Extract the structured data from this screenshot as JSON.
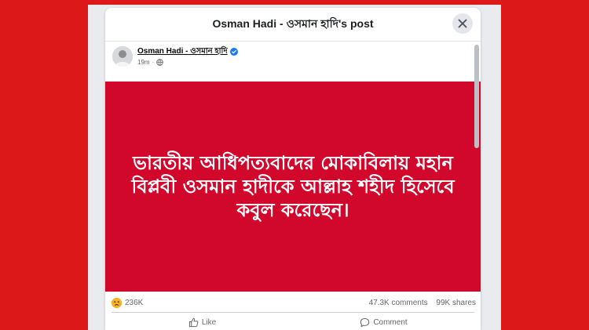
{
  "dialog": {
    "title": "Osman Hadi - ওসমান হাদি's post",
    "close_icon": "close-icon"
  },
  "post": {
    "author": "Osman Hadi - ওসমান হাদি",
    "time": "19m",
    "audience_icon": "globe-icon",
    "banner_text": "ভারতীয় আধিপত্যবাদের মোকাবিলায় মহান বিপ্লবী ওসমান হাদীকে আল্লাহ শহীদ হিসেবে কবুল করেছেন।",
    "banner_color": "#d1072c"
  },
  "stats": {
    "reaction_count": "236K",
    "comments": "47.3K comments",
    "shares": "99K shares"
  },
  "actions": {
    "like": "Like",
    "comment": "Comment"
  },
  "colors": {
    "page_background": "#dc1818",
    "accent": "#1877f2"
  }
}
